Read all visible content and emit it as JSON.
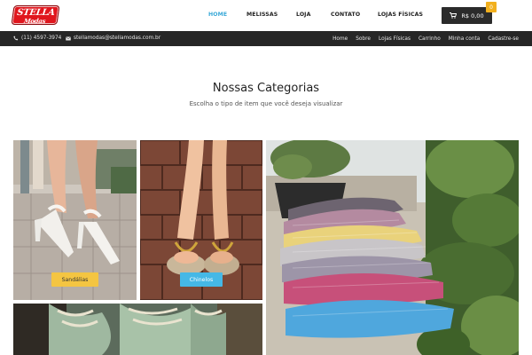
{
  "brand": {
    "logo_main": "STELLA",
    "logo_sub": "Modas"
  },
  "nav": {
    "items": [
      {
        "label": "HOME",
        "active": true
      },
      {
        "label": "MELISSAS",
        "active": false
      },
      {
        "label": "LOJA",
        "active": false
      },
      {
        "label": "CONTATO",
        "active": false
      },
      {
        "label": "LOJAS FÍSICAS",
        "active": false
      }
    ],
    "cart_total": "R$ 0,00",
    "cart_count": "0"
  },
  "topbar": {
    "phone": "(11) 4597-3974",
    "email": "stellamodas@stellamodas.com.br",
    "links": [
      "Home",
      "Sobre",
      "Lojas Físicas",
      "Carrinho",
      "Minha conta",
      "Cadastre-se"
    ]
  },
  "section": {
    "title": "Nossas Categorias",
    "subtitle": "Escolha o tipo de item que você deseja visualizar"
  },
  "categories": [
    {
      "label": "Sandálias",
      "label_color": "#f4c542"
    },
    {
      "label": "Chinelos",
      "label_color": "#45b8e6"
    },
    {
      "label": "",
      "label_color": ""
    },
    {
      "label": "",
      "label_color": ""
    }
  ],
  "icons": {
    "phone": "phone-icon",
    "email": "envelope-icon",
    "cart": "shopping-cart-icon"
  }
}
